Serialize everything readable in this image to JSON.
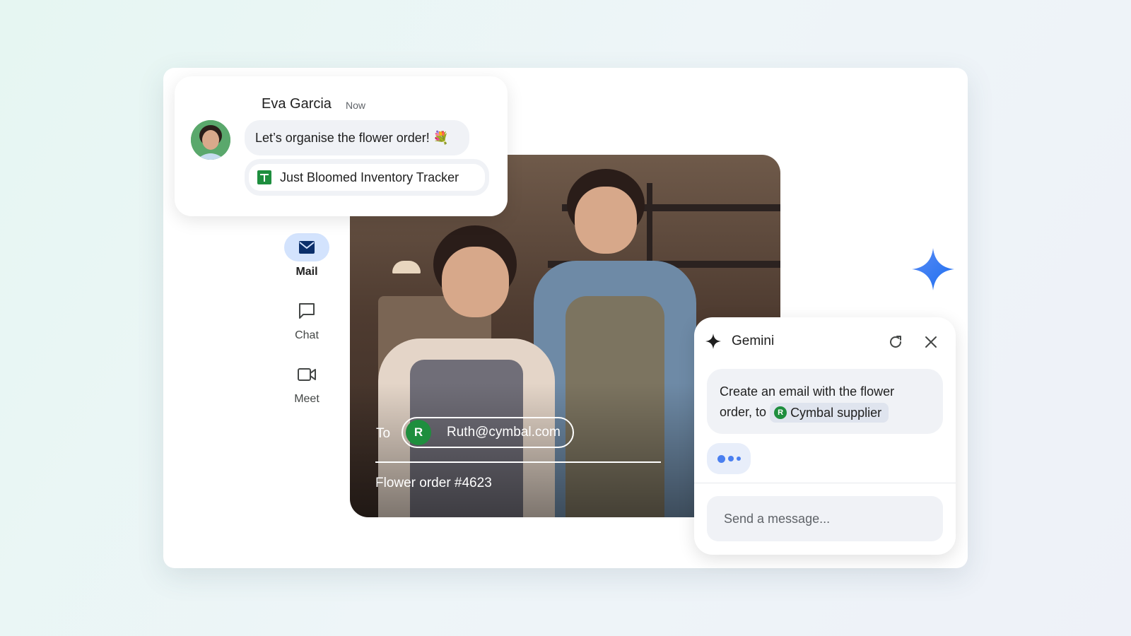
{
  "nav": {
    "items": [
      {
        "label": "Mail",
        "icon": "mail-icon",
        "active": true
      },
      {
        "label": "Chat",
        "icon": "chat-icon",
        "active": false
      },
      {
        "label": "Meet",
        "icon": "video-icon",
        "active": false
      }
    ]
  },
  "chat_notification": {
    "sender": "Eva Garcia",
    "time": "Now",
    "message": "Let’s organise the flower order! 💐",
    "attachment": {
      "name": "Just Bloomed Inventory Tracker",
      "icon": "sheets-icon"
    }
  },
  "compose": {
    "to_label": "To",
    "recipient_initial": "R",
    "recipient_email": "Ruth@cymbal.com",
    "subject": "Flower order #4623"
  },
  "gemini": {
    "title": "Gemini",
    "prompt_text": "Create an email with the flower order, to",
    "chip_initial": "R",
    "chip_label": "Cymbal supplier",
    "input_placeholder": "Send a message..."
  },
  "colors": {
    "accent_blue": "#4a7ff0",
    "active_nav_bg": "#d3e3fd",
    "recipient_green": "#1e8e3e",
    "sheets_green": "#1e8e3e"
  }
}
